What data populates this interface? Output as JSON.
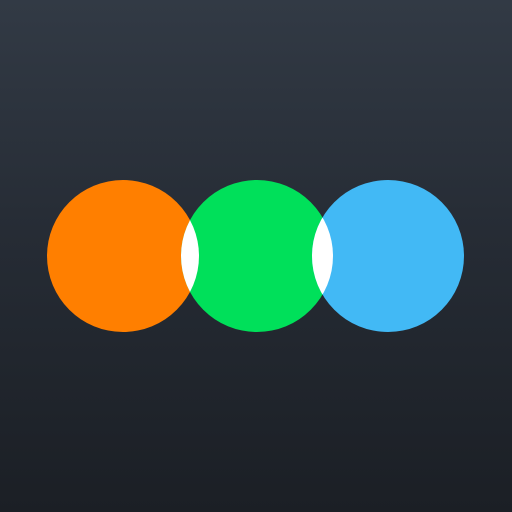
{
  "app_icon": {
    "name": "three-circles-logo",
    "colors": {
      "background_top": "#323a45",
      "background_bottom": "#1b1f25",
      "left_circle": "#ff7f00",
      "middle_circle": "#00e05a",
      "right_circle": "#42b9f5",
      "overlap": "#ffffff"
    },
    "shapes": [
      "orange-circle",
      "green-circle",
      "blue-circle"
    ]
  }
}
